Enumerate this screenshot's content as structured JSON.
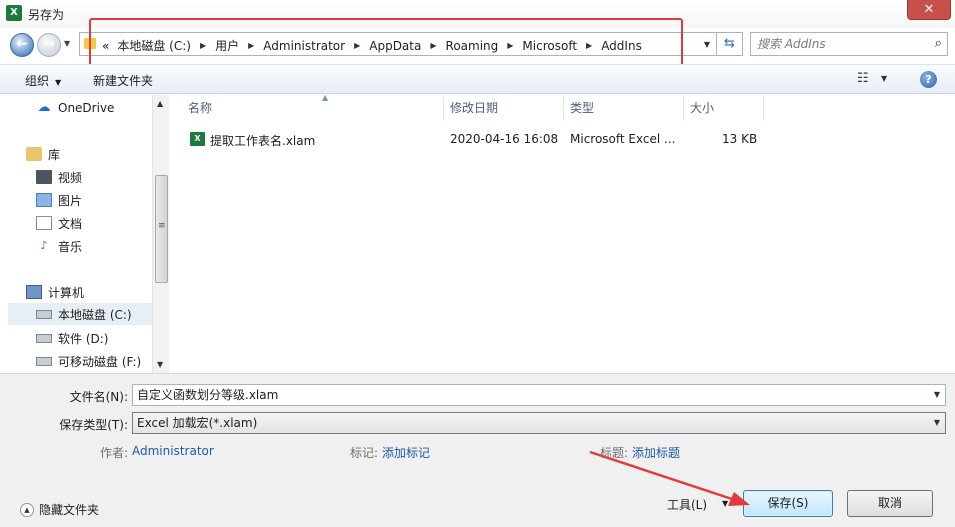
{
  "window": {
    "title": "另存为",
    "app_icon": "X",
    "close_glyph": "✕"
  },
  "address": {
    "lead": "«",
    "crumbs": [
      "本地磁盘 (C:)",
      "用户",
      "Administrator",
      "AppData",
      "Roaming",
      "Microsoft",
      "AddIns"
    ]
  },
  "search": {
    "placeholder": "搜索 AddIns"
  },
  "toolbar": {
    "organize": "组织",
    "new_folder": "新建文件夹"
  },
  "nav": {
    "items": [
      {
        "label": "OneDrive",
        "icon": "cloud-icon"
      },
      {
        "label": "库",
        "icon": "library-icon"
      },
      {
        "label": "视频",
        "icon": "video-icon"
      },
      {
        "label": "图片",
        "icon": "picture-icon"
      },
      {
        "label": "文档",
        "icon": "document-icon"
      },
      {
        "label": "音乐",
        "icon": "music-icon"
      },
      {
        "label": "计算机",
        "icon": "computer-icon"
      },
      {
        "label": "本地磁盘 (C:)",
        "icon": "drive-icon"
      },
      {
        "label": "软件 (D:)",
        "icon": "drive-icon"
      },
      {
        "label": "可移动磁盘 (F:)",
        "icon": "removable-drive-icon"
      }
    ]
  },
  "columns": {
    "name": "名称",
    "modified": "修改日期",
    "type": "类型",
    "size": "大小"
  },
  "files": [
    {
      "name": "提取工作表名.xlam",
      "modified": "2020-04-16 16:08",
      "type": "Microsoft Excel ...",
      "size": "13 KB"
    }
  ],
  "form": {
    "filename_label": "文件名(N):",
    "filename_value": "自定义函数划分等级.xlam",
    "type_label": "保存类型(T):",
    "type_value": "Excel 加载宏(*.xlam)",
    "author_label": "作者:",
    "author_value": "Administrator",
    "tags_label": "标记:",
    "tags_value": "添加标记",
    "title_label": "标题:",
    "title_value": "添加标题"
  },
  "footer": {
    "hide_folders": "隐藏文件夹",
    "tools": "工具(L)",
    "save": "保存(S)",
    "cancel": "取消"
  },
  "colors": {
    "annotation_red": "#e23b3b",
    "link_blue": "#1e5aa8",
    "excel_green": "#1d7a3c"
  }
}
